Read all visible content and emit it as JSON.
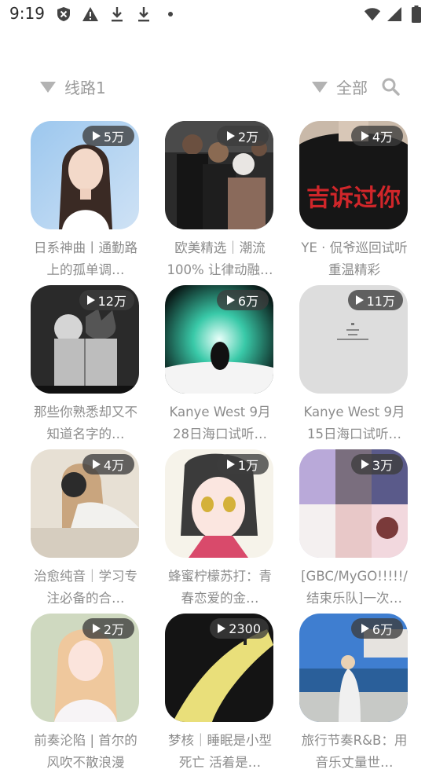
{
  "status_bar": {
    "time": "9:19",
    "left_icons": [
      "shield-icon",
      "warning-icon",
      "download-icon",
      "download-icon",
      "dot-icon"
    ],
    "right_icons": [
      "wifi-icon",
      "signal-icon",
      "battery-icon"
    ]
  },
  "toolbar": {
    "route_label": "线路1",
    "filter_label": "全部"
  },
  "colors": {
    "text_gray": "#8c8c8c",
    "badge_bg": "#3c3c3c"
  },
  "playlists": [
    {
      "plays": "5万",
      "title": "日系神曲丨通勤路上的孤单调…"
    },
    {
      "plays": "2万",
      "title": "欧美精选｜潮流100% 让律动融…"
    },
    {
      "plays": "4万",
      "title": "YE · 侃爷巡回试听 重温精彩"
    },
    {
      "plays": "12万",
      "title": "那些你熟悉却又不知道名字的…"
    },
    {
      "plays": "6万",
      "title": "Kanye West 9月28日海口试听…"
    },
    {
      "plays": "11万",
      "title": "Kanye West 9月15日海口试听…"
    },
    {
      "plays": "4万",
      "title": "治愈纯音｜学习专注必备的合…"
    },
    {
      "plays": "1万",
      "title": "蜂蜜柠檬苏打：青春恋爱的金…"
    },
    {
      "plays": "3万",
      "title": "[GBC/MyGO!!!!!/结束乐队]一次…"
    },
    {
      "plays": "2万",
      "title": "前奏沦陷 | 首尔的风吹不散浪漫"
    },
    {
      "plays": "2300",
      "title": "梦核｜睡眠是小型死亡 活着是…"
    },
    {
      "plays": "6万",
      "title": "旅行节奏R&B：用音乐丈量世…"
    }
  ],
  "cover_texts": {
    "card_3": "吉诉过你"
  }
}
